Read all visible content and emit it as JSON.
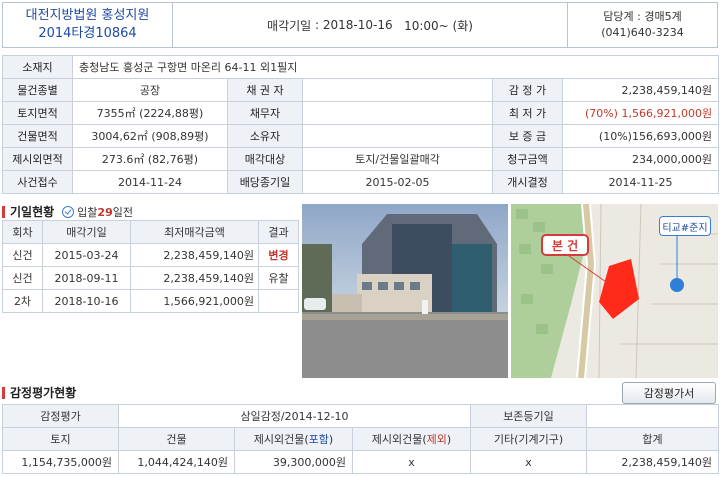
{
  "header": {
    "court": "대전지방법원 홍성지원",
    "case_no": "2014타경10864",
    "sale_date_label": "매각기일",
    "sale_date": "2018-10-16",
    "sale_time": "10:00~ (화)",
    "dept": "담당계 : 경매5계",
    "phone": "(041)640-3234"
  },
  "info": {
    "address_label": "소재지",
    "address": "충청남도 홍성군 구항면 마온리 64-11 외1필지",
    "type_label": "물건종별",
    "type": "공장",
    "creditor_label": "채 권 자",
    "creditor": "",
    "appraisal_label": "감 정 가",
    "appraisal": "2,238,459,140원",
    "land_area_label": "토지면적",
    "land_area": "7355㎡ (2224,88평)",
    "debtor_label": "채무자",
    "debtor": "",
    "min_price_label": "최 저 가",
    "min_price": "(70%) 1,566,921,000원",
    "bldg_area_label": "건물면적",
    "bldg_area": "3004,62㎡ (908,89평)",
    "owner_label": "소유자",
    "owner": "",
    "deposit_label": "보 증 금",
    "deposit": "(10%)156,693,000원",
    "excl_area_label": "제시외면적",
    "excl_area": "273.6㎡ (82,76평)",
    "target_label": "매각대상",
    "target": "토지/건물일괄매각",
    "claim_label": "청구금액",
    "claim": "234,000,000원",
    "filed_label": "사건접수",
    "filed": "2014-11-24",
    "dividend_label": "배당종기일",
    "dividend": "2015-02-05",
    "start_label": "개시결정",
    "start": "2014-11-25"
  },
  "history": {
    "title": "기일현황",
    "days_prefix": "입찰",
    "days_num": "29",
    "days_suffix": "일전",
    "headers": [
      "회차",
      "매각기일",
      "최저매각금액",
      "결과"
    ],
    "rows": [
      {
        "round": "신건",
        "date": "2015-03-24",
        "price": "2,238,459,140원",
        "result": "변경"
      },
      {
        "round": "신건",
        "date": "2018-09-11",
        "price": "2,238,459,140원",
        "result": "유찰"
      },
      {
        "round": "2차",
        "date": "2018-10-16",
        "price": "1,566,921,000원",
        "result": ""
      }
    ]
  },
  "map": {
    "main_label": "본 건",
    "station_label": "티교#준지"
  },
  "appraisal": {
    "title": "감정평가현황",
    "button": "감정평가서",
    "h_appraisal": "감정평가",
    "org_date": "삼일감정/2014-12-10",
    "h_preserve": "보존등기일",
    "preserve": "",
    "cols": [
      "토지",
      "건물",
      "제시외건물(포함)",
      "제시외건물(제외)",
      "기타(기계기구)",
      "합계"
    ],
    "col3_pre": "제시외건물(",
    "col3_em": "포함",
    "col4_em": "제외",
    "col_post": ")",
    "values": [
      "1,154,735,000원",
      "1,044,424,140원",
      "39,300,000원",
      "x",
      "x",
      "2,238,459,140원"
    ]
  }
}
